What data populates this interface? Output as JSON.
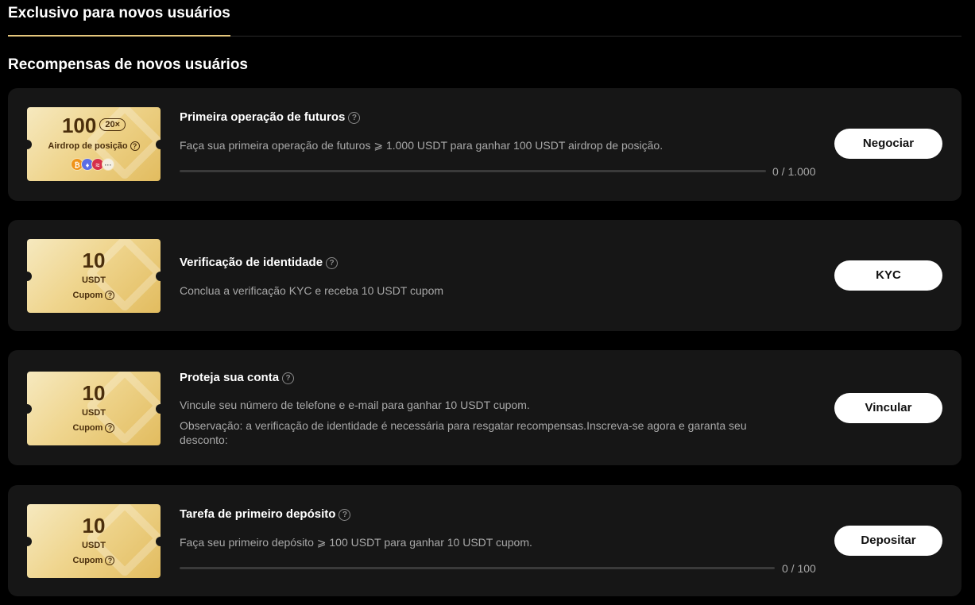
{
  "tabs": [
    {
      "label": "Exclusivo para novos usuários",
      "active": true
    }
  ],
  "section_title": "Recompensas de novos usuários",
  "tasks": [
    {
      "coupon": {
        "amount": "100",
        "leverage": "20×",
        "label": "Airdrop de posição",
        "coins": [
          "bitcoin-coin-icon",
          "ethereum-coin-icon",
          "token-coin-icon",
          "more-coins-icon"
        ],
        "more": "···"
      },
      "title": "Primeira operação de futuros",
      "description": "Faça sua primeira operação de futuros ⩾ 1.000 USDT para ganhar 100 USDT airdrop de posição.",
      "progress": {
        "current": "0",
        "target": "1.000",
        "text": "0  / 1.000",
        "fraction": 0
      },
      "button": "Negociar"
    },
    {
      "coupon": {
        "amount": "10",
        "unit": "USDT",
        "label": "Cupom"
      },
      "title": "Verificação de identidade",
      "description": "Conclua a verificação KYC e receba 10 USDT cupom",
      "button": "KYC"
    },
    {
      "coupon": {
        "amount": "10",
        "unit": "USDT",
        "label": "Cupom"
      },
      "title": "Proteja sua conta",
      "description": "Vincule seu número de telefone e e-mail para ganhar 10 USDT cupom.",
      "note": "Observação: a verificação de identidade é necessária para resgatar recompensas.Inscreva-se agora e garanta seu desconto:",
      "button": "Vincular"
    },
    {
      "coupon": {
        "amount": "10",
        "unit": "USDT",
        "label": "Cupom"
      },
      "title": "Tarefa de primeiro depósito",
      "description": "Faça seu primeiro depósito ⩾ 100 USDT para ganhar 10 USDT cupom.",
      "progress": {
        "current": "0",
        "target": "100",
        "text": "0  / 100",
        "fraction": 0
      },
      "button": "Depositar"
    }
  ],
  "colors": {
    "background": "#000000",
    "card": "#161616",
    "accent_gold": "#e6c77d",
    "button_bg": "#ffffff"
  },
  "help_glyph": "?"
}
